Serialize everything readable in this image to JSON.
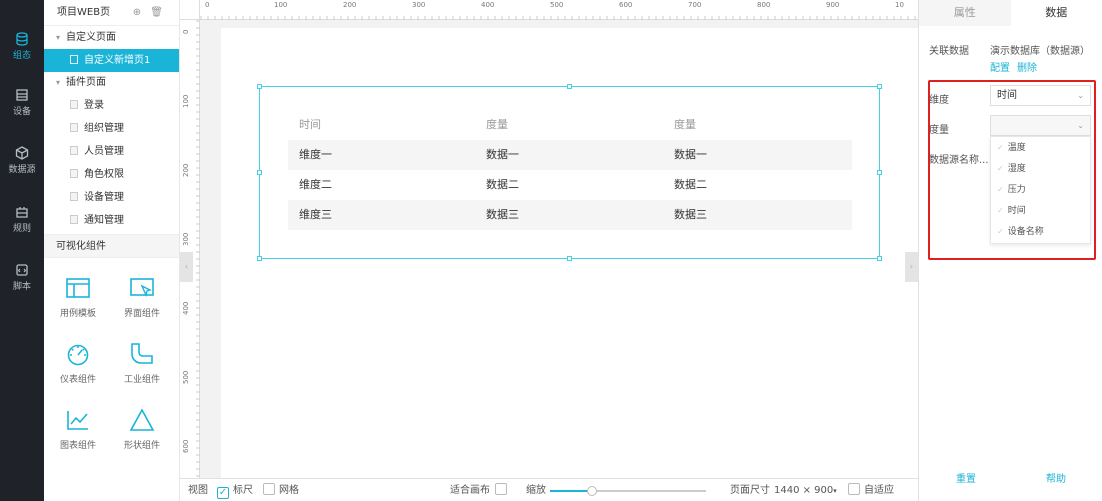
{
  "nav": {
    "items": [
      {
        "label": "组态",
        "icon": "database-icon",
        "active": true
      },
      {
        "label": "设备",
        "icon": "device-icon",
        "active": false
      },
      {
        "label": "数据源",
        "icon": "data-source-icon",
        "active": false
      },
      {
        "label": "规则",
        "icon": "rule-icon",
        "active": false
      },
      {
        "label": "脚本",
        "icon": "script-icon",
        "active": false
      }
    ]
  },
  "tree": {
    "title": "项目WEB页",
    "add_icon": "add-icon",
    "delete_icon": "delete-icon",
    "custom_group": "自定义页面",
    "custom_pages": [
      "自定义新增页1"
    ],
    "plugin_group": "插件页面",
    "plugin_pages": [
      "登录",
      "组织管理",
      "人员管理",
      "角色权限",
      "设备管理",
      "通知管理"
    ],
    "viz_title": "可视化组件",
    "components": [
      {
        "label": "用例模板",
        "icon": "template-icon"
      },
      {
        "label": "界面组件",
        "icon": "ui-component-icon"
      },
      {
        "label": "仪表组件",
        "icon": "gauge-icon"
      },
      {
        "label": "工业组件",
        "icon": "pipe-icon"
      },
      {
        "label": "图表组件",
        "icon": "chart-icon"
      },
      {
        "label": "形状组件",
        "icon": "triangle-icon"
      }
    ]
  },
  "ruler": {
    "top_ticks": [
      "0",
      "100",
      "200",
      "300",
      "400",
      "500",
      "600",
      "700",
      "800",
      "900",
      "10"
    ],
    "left_ticks": [
      "0",
      "100",
      "200",
      "300",
      "400",
      "500",
      "600"
    ]
  },
  "table": {
    "headers": [
      "时间",
      "度量",
      "度量"
    ],
    "rows": [
      [
        "维度一",
        "数据一",
        "数据一"
      ],
      [
        "维度二",
        "数据二",
        "数据二"
      ],
      [
        "维度三",
        "数据三",
        "数据三"
      ]
    ]
  },
  "bottom": {
    "view": "视图",
    "ruler": "标尺",
    "ruler_checked": true,
    "grid": "网格",
    "grid_checked": false,
    "fit": "适合画布",
    "zoom": "缩放",
    "zoom_fraction": 0.27,
    "page_size_label": "页面尺寸",
    "page_size": "1440 × 900",
    "auto_fit": "自适应",
    "auto_fit_checked": false
  },
  "right": {
    "tabs": [
      "属性",
      "数据"
    ],
    "active_tab": "数据",
    "related_label": "关联数据",
    "related_value": "演示数据库（数据源）",
    "config_link": "配置",
    "delete_link": "删除",
    "dimension_label": "维度",
    "dimension_value": "时间",
    "measure_label": "度量",
    "measure_value": "",
    "source_name_label": "数据源名称...",
    "options": [
      "温度",
      "湿度",
      "压力",
      "时间",
      "设备名称"
    ],
    "reset": "重置",
    "help": "帮助",
    "highlight_color": "#e02020",
    "accent_color": "#1ab4d8"
  }
}
